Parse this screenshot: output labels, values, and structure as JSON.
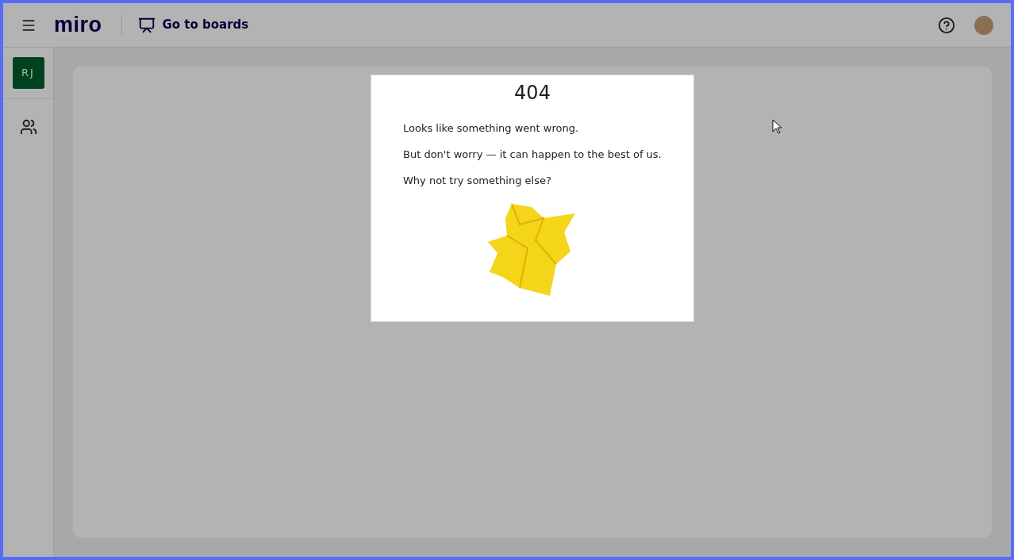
{
  "header": {
    "logo": "miro",
    "go_to_boards": "Go to boards"
  },
  "sidebar": {
    "team_initials": "RJ"
  },
  "error_card": {
    "code": "404",
    "lines": [
      "Looks like something went wrong.",
      "But don't worry — it can happen to the best of us.",
      "Why not try something else?"
    ]
  }
}
